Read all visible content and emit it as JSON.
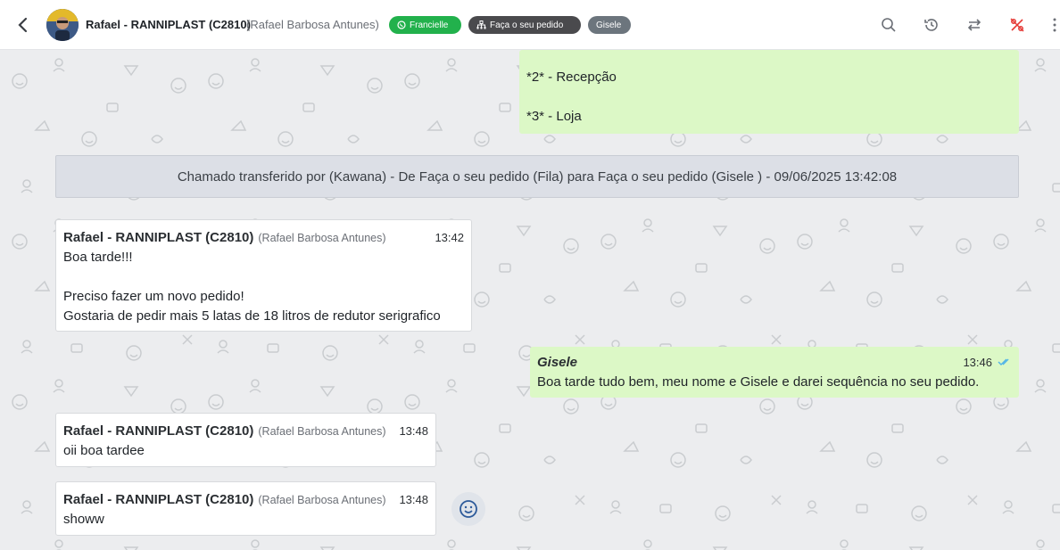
{
  "header": {
    "contact_name": "Rafael - RANNIPLAST (C2810)",
    "contact_sub": "(Rafael Barbosa Antunes)",
    "tags": [
      {
        "label": "Francielle",
        "icon": "whatsapp-icon",
        "color": "#22b14c"
      },
      {
        "label": "Faça o seu pedido",
        "icon": "sitemap-icon",
        "color": "#4a4a4d"
      },
      {
        "label": "Gisele",
        "color": "#6c757d"
      }
    ],
    "actions": [
      "search-icon",
      "history-icon",
      "transfer-icon",
      "percent-icon",
      "more-icon"
    ]
  },
  "messages": {
    "top_outgoing": {
      "lines": [
        "*2* - Recepção",
        "",
        "*3* - Loja"
      ]
    },
    "system": "Chamado transferido por (Kawana) - De Faça o seu pedido (Fila) para Faça o seu pedido (Gisele ) - 09/06/2025 13:42:08",
    "m1": {
      "sender": "Rafael - RANNIPLAST (C2810)",
      "sender_sub": "(Rafael Barbosa Antunes)",
      "time": "13:42",
      "lines": [
        "Boa tarde!!!",
        "",
        "Preciso fazer um novo pedido!",
        "Gostaria de pedir mais 5 latas de 18 litros de redutor serigrafico"
      ]
    },
    "m2": {
      "sender": "Gisele",
      "time": "13:46",
      "text": "Boa tarde tudo bem, meu nome e Gisele e darei sequência no seu pedido."
    },
    "m3": {
      "sender": "Rafael - RANNIPLAST (C2810)",
      "sender_sub": "(Rafael Barbosa Antunes)",
      "time": "13:48",
      "text": "oii boa tardee"
    },
    "m4": {
      "sender": "Rafael - RANNIPLAST (C2810)",
      "sender_sub": "(Rafael Barbosa Antunes)",
      "time": "13:48",
      "text": "showw"
    }
  },
  "colors": {
    "incoming_bubble": "#ffffff",
    "outgoing_bubble": "#dcf8c6",
    "system_bar": "#dcdfe6",
    "read_check": "#4fb3e8",
    "alert_icon": "#e53935"
  }
}
